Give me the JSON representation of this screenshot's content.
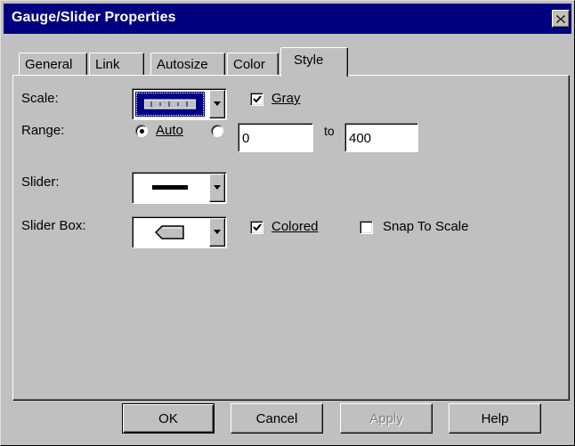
{
  "window": {
    "title": "Gauge/Slider Properties",
    "close_icon": "close-icon",
    "title_bar_color": "#000080"
  },
  "tabs": [
    {
      "label": "General",
      "active": false
    },
    {
      "label": "Link",
      "active": false
    },
    {
      "label": "Autosize",
      "active": false
    },
    {
      "label": "Color",
      "active": false
    },
    {
      "label": "Style",
      "active": true
    }
  ],
  "style_tab": {
    "scale": {
      "label": "Scale:",
      "selected_icon": "scale-ticks-icon"
    },
    "gray": {
      "label": "Gray",
      "checked": true
    },
    "range": {
      "label": "Range:",
      "auto_label": "Auto",
      "auto_selected": true,
      "custom_selected": false,
      "from_value": "0",
      "to_label": "to",
      "to_value": "400"
    },
    "slider": {
      "label": "Slider:",
      "selected_icon": "slider-line-icon"
    },
    "slider_box": {
      "label": "Slider Box:",
      "selected_icon": "slider-box-shape-icon"
    },
    "colored": {
      "label": "Colored",
      "checked": true
    },
    "snap_to_scale": {
      "label": "Snap To Scale",
      "checked": false
    }
  },
  "buttons": {
    "ok": "OK",
    "cancel": "Cancel",
    "apply": "Apply",
    "help": "Help"
  }
}
